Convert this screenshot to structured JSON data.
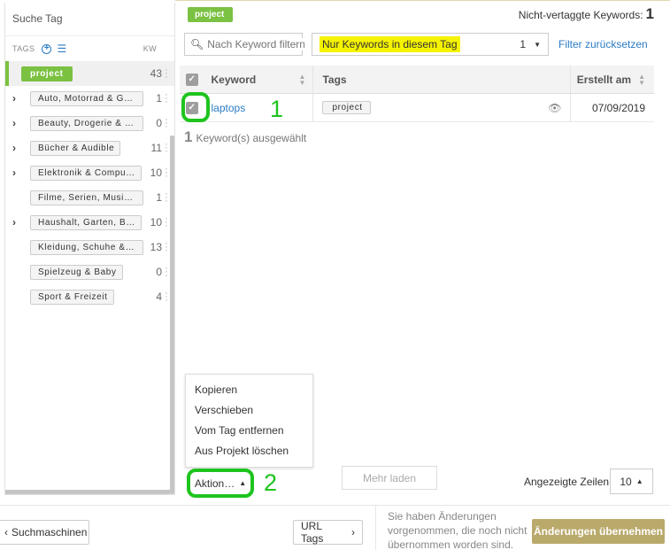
{
  "sidebar": {
    "search_placeholder": "Suche Tag",
    "tags_label": "TAGS",
    "kw_label": "KW",
    "tags": [
      {
        "label": "project",
        "count": "43",
        "active": true,
        "expandable": false
      },
      {
        "label": "Auto, Motorrad & Ge…",
        "count": "1",
        "expandable": true
      },
      {
        "label": "Beauty, Drogerie & Le…",
        "count": "0",
        "expandable": true
      },
      {
        "label": "Bücher & Audible",
        "count": "11",
        "expandable": true
      },
      {
        "label": "Elektronik & Compu…",
        "count": "10",
        "expandable": true
      },
      {
        "label": "Filme, Serien, Musik …",
        "count": "1",
        "expandable": false
      },
      {
        "label": "Haushalt, Garten, B…",
        "count": "10",
        "expandable": true
      },
      {
        "label": "Kleidung, Schuhe & …",
        "count": "13",
        "expandable": false
      },
      {
        "label": "Spielzeug & Baby",
        "count": "0",
        "expandable": false
      },
      {
        "label": "Sport & Freizeit",
        "count": "4",
        "expandable": false
      }
    ]
  },
  "main": {
    "current_tag": "project",
    "untagged_label": "Nicht-vertaggte Keywords:",
    "untagged_count": "1",
    "keyword_search_placeholder": "Nach Keyword filtern",
    "only_in_tag_label": "Nur Keywords in diesem Tag",
    "only_in_tag_count": "1",
    "filter_reset": "Filter zurücksetzen",
    "table": {
      "headers": {
        "keyword": "Keyword",
        "tags": "Tags",
        "created": "Erstellt am"
      },
      "rows": [
        {
          "keyword": "laptops",
          "tag": "project",
          "created": "07/09/2019"
        }
      ]
    },
    "annotation_1": "1",
    "annotation_2": "2",
    "selected_count": "1",
    "selected_label": "Keyword(s) ausgewählt",
    "action_menu": [
      "Kopieren",
      "Verschieben",
      "Vom Tag entfernen",
      "Aus Projekt löschen"
    ],
    "action_button": "Aktion…",
    "load_more": "Mehr laden",
    "rows_label": "Angezeigte Zeilen",
    "rows_value": "10"
  },
  "footer": {
    "search_engines": "Suchmaschinen",
    "url_tags": "URL Tags",
    "unsaved_text": "Sie haben Änderungen vorgenommen, die noch nicht übernommen worden sind.",
    "apply_button": "Änderungen übernehmen"
  },
  "colors": {
    "accent_green": "#7bc142",
    "link_blue": "#2a7bc4",
    "highlight": "#f6f300",
    "apply": "#b9a96b",
    "annotation": "#1ec41e"
  }
}
